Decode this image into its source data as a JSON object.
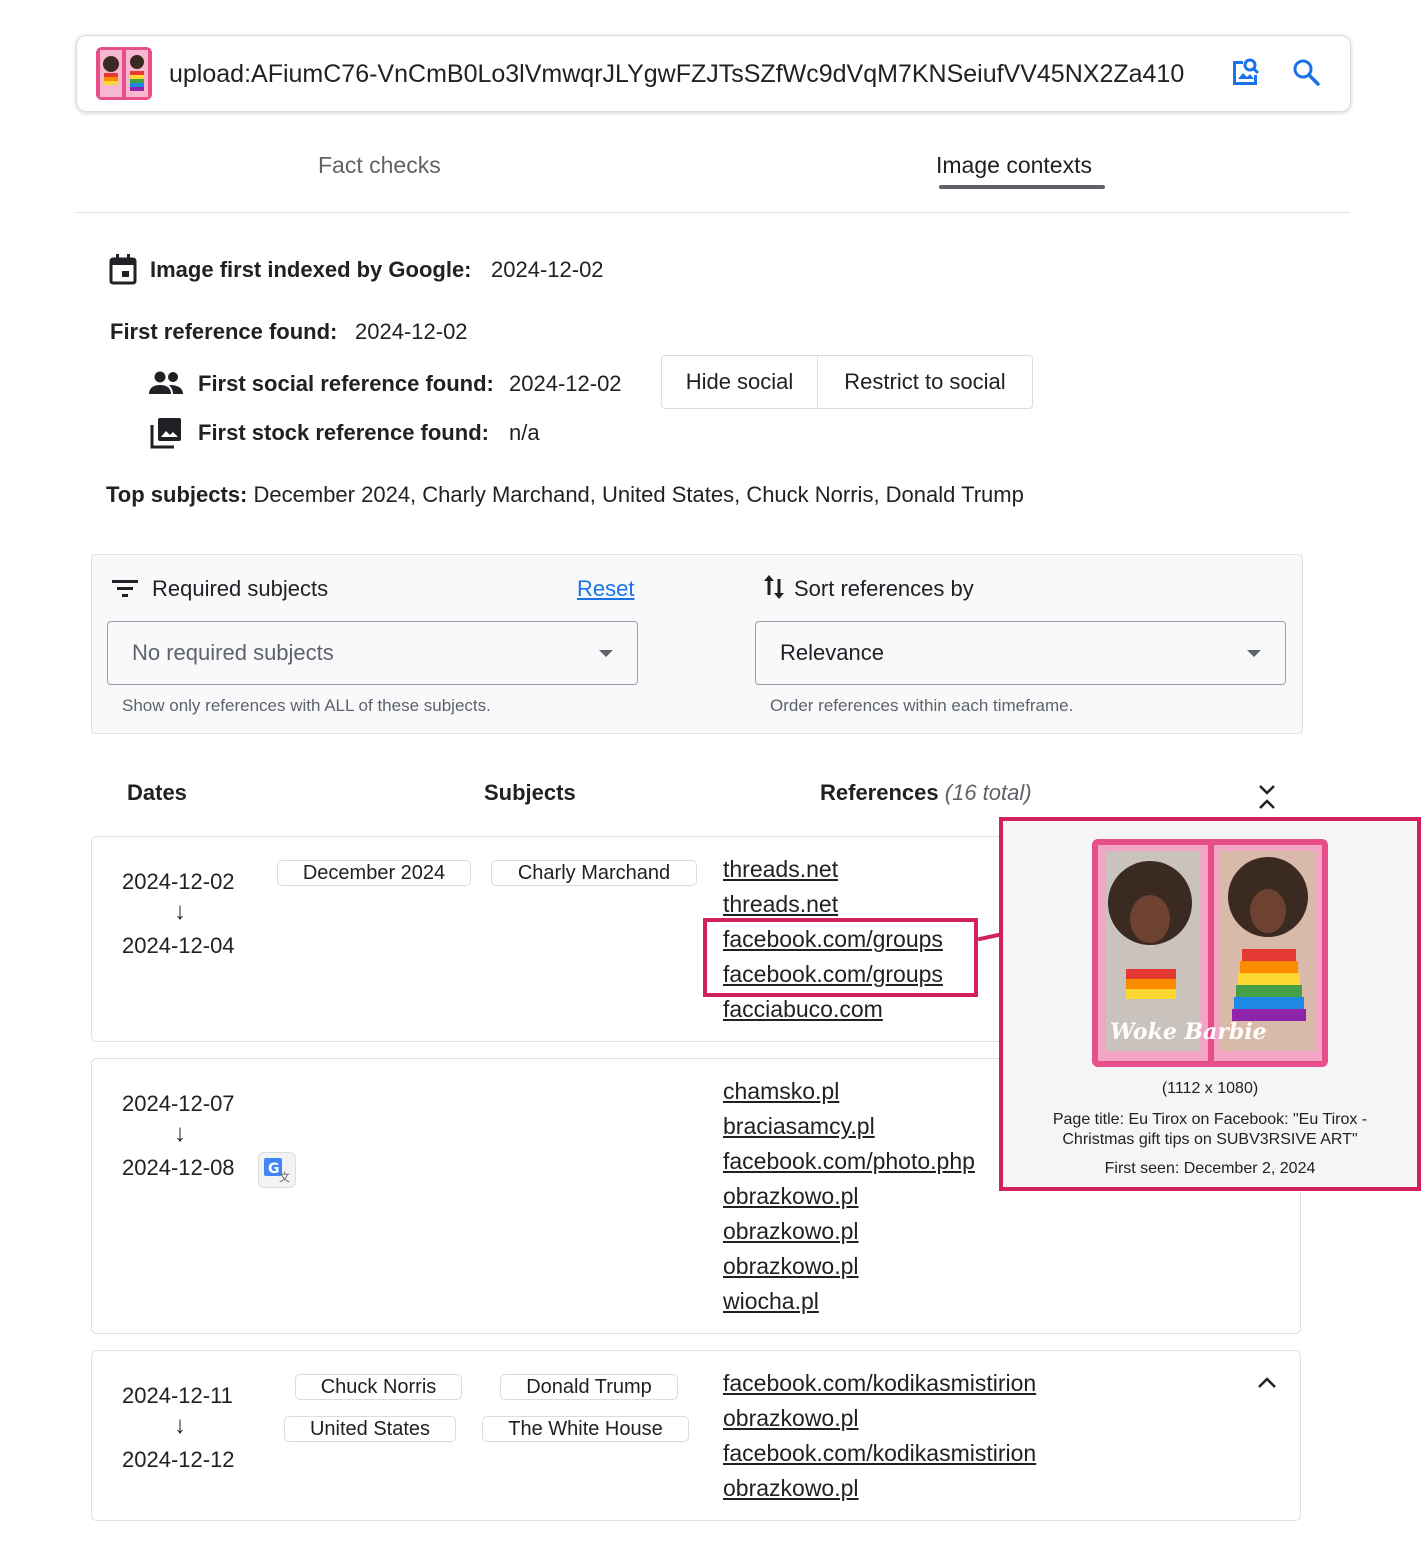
{
  "search": {
    "query": "upload:AFiumC76-VnCmB0Lo3lVmwqrJLYgwFZJTsSZfWc9dVqM7KNSeiufVV45NX2Za410",
    "thumbnail_text": "Woke Barbie",
    "image_search_icon": "image-search-icon",
    "search_icon": "search-icon"
  },
  "tabs": [
    {
      "label": "Fact checks",
      "active": false
    },
    {
      "label": "Image contexts",
      "active": true
    }
  ],
  "summary": {
    "first_indexed_label": "Image first indexed by Google:",
    "first_indexed_value": "2024-12-02",
    "first_reference_label": "First reference found:",
    "first_reference_value": "2024-12-02",
    "first_social_label": "First social reference found:",
    "first_social_value": "2024-12-02",
    "first_stock_label": "First stock reference found:",
    "first_stock_value": "n/a",
    "hide_social": "Hide social",
    "restrict_social": "Restrict to social",
    "top_subjects_label": "Top subjects:",
    "top_subjects_value": "December 2024, Charly Marchand, United States, Chuck Norris, Donald Trump"
  },
  "filters": {
    "required_label": "Required subjects",
    "reset": "Reset",
    "required_value": "No required subjects",
    "required_hint": "Show only references with ALL of these subjects.",
    "sort_label": "Sort references by",
    "sort_value": "Relevance",
    "sort_hint": "Order references within each timeframe."
  },
  "columns": {
    "dates": "Dates",
    "subjects": "Subjects",
    "references": "References",
    "total": "(16 total)"
  },
  "groups": [
    {
      "date_start": "2024-12-02",
      "arrow": "↓",
      "date_end": "2024-12-04",
      "subjects": [
        "December 2024",
        "Charly Marchand"
      ],
      "refs": [
        "threads.net",
        "threads.net",
        "facebook.com/groups",
        "facebook.com/groups",
        "facciabuco.com"
      ]
    },
    {
      "date_start": "2024-12-07",
      "arrow": "↓",
      "date_end": "2024-12-08",
      "subjects": [],
      "refs": [
        "chamsko.pl",
        "braciasamcy.pl",
        "facebook.com/photo.php",
        "obrazkowo.pl",
        "obrazkowo.pl",
        "obrazkowo.pl",
        "wiocha.pl"
      ]
    },
    {
      "date_start": "2024-12-11",
      "arrow": "↓",
      "date_end": "2024-12-12",
      "subjects": [
        "Chuck Norris",
        "Donald Trump",
        "United States",
        "The White House"
      ],
      "refs": [
        "facebook.com/kodikasmistirion",
        "obrazkowo.pl",
        "facebook.com/kodikasmistirion",
        "obrazkowo.pl"
      ]
    }
  ],
  "tooltip": {
    "image_text": "Woke Barbie",
    "dimensions": "(1112 x 1080)",
    "page_title": "Page title: Eu Tirox on Facebook: \"Eu Tirox - Christmas gift tips on SUBV3RSIVE ART\"",
    "first_seen": "First seen: December 2, 2024"
  },
  "colors": {
    "accent": "#1a73e8",
    "highlight": "#d21f5f"
  }
}
